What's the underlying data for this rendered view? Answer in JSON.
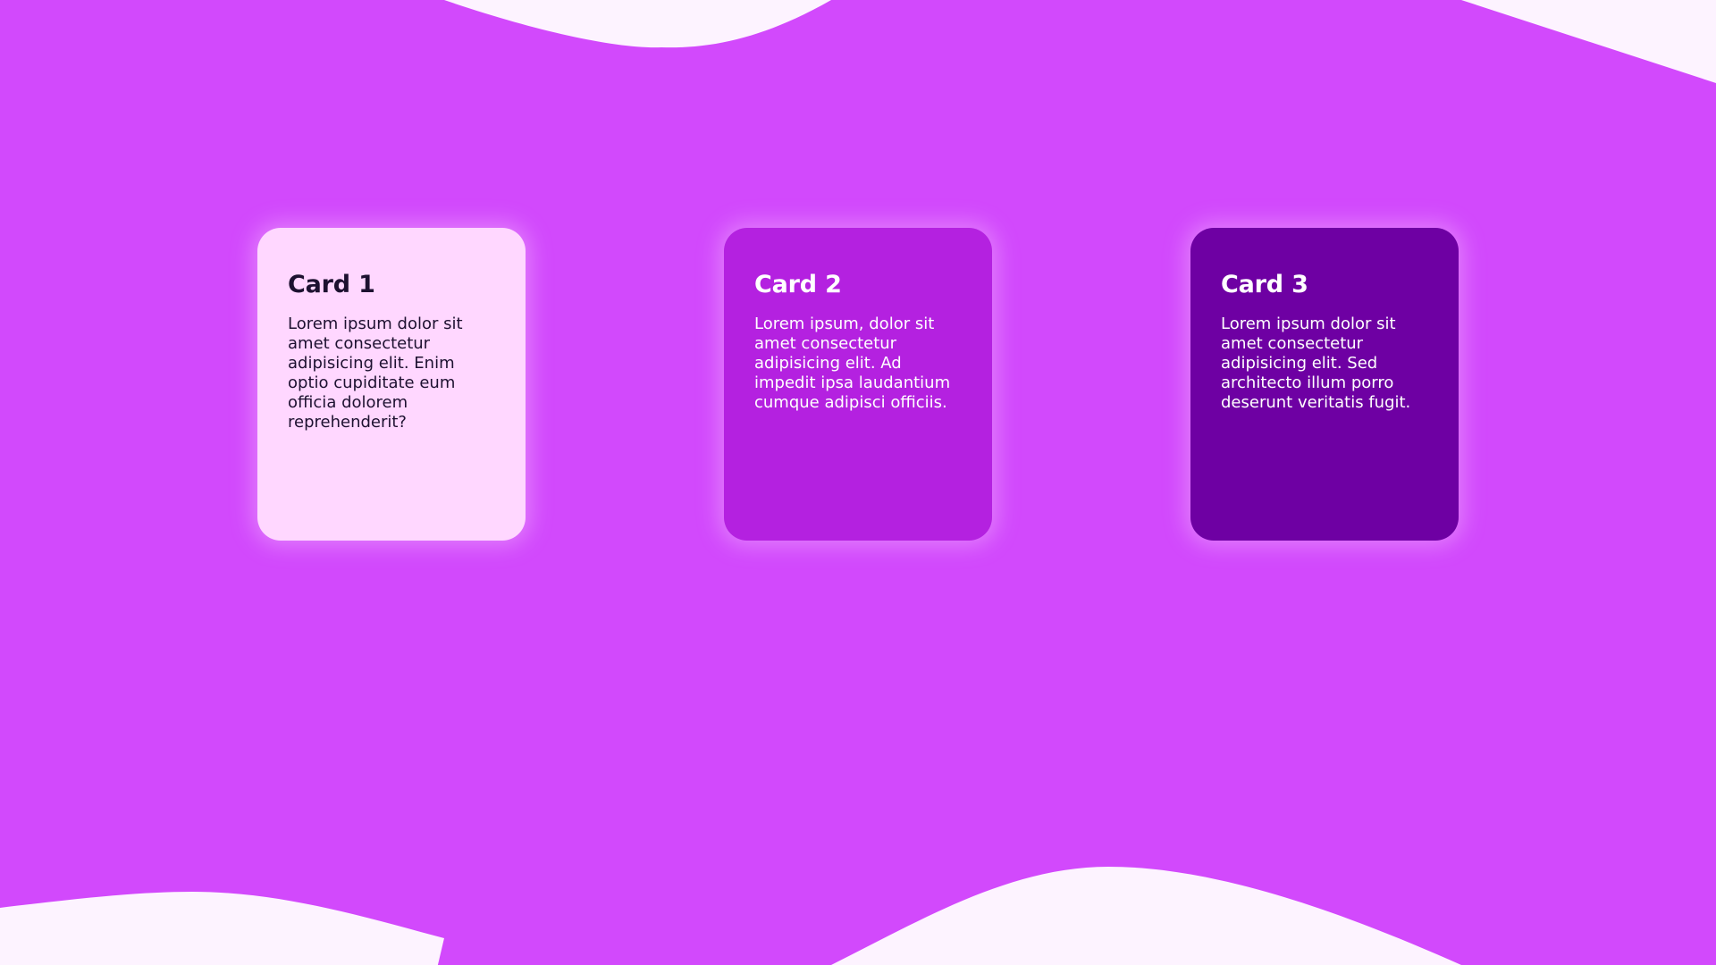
{
  "colors": {
    "background": "#d249fc",
    "wave": "#fdf3ff",
    "card1_bg": "#ffd7ff",
    "card2_bg": "#b421e0",
    "card3_bg": "#6e00a3"
  },
  "cards": [
    {
      "title": "Card 1",
      "text": "Lorem ipsum dolor sit amet consectetur adipisicing elit. Enim optio cupiditate eum officia dolorem reprehenderit?"
    },
    {
      "title": "Card 2",
      "text": "Lorem ipsum, dolor sit amet consectetur adipisicing elit. Ad impedit ipsa laudantium cumque adipisci officiis."
    },
    {
      "title": "Card 3",
      "text": "Lorem ipsum dolor sit amet consectetur adipisicing elit. Sed architecto illum porro deserunt veritatis fugit."
    }
  ]
}
